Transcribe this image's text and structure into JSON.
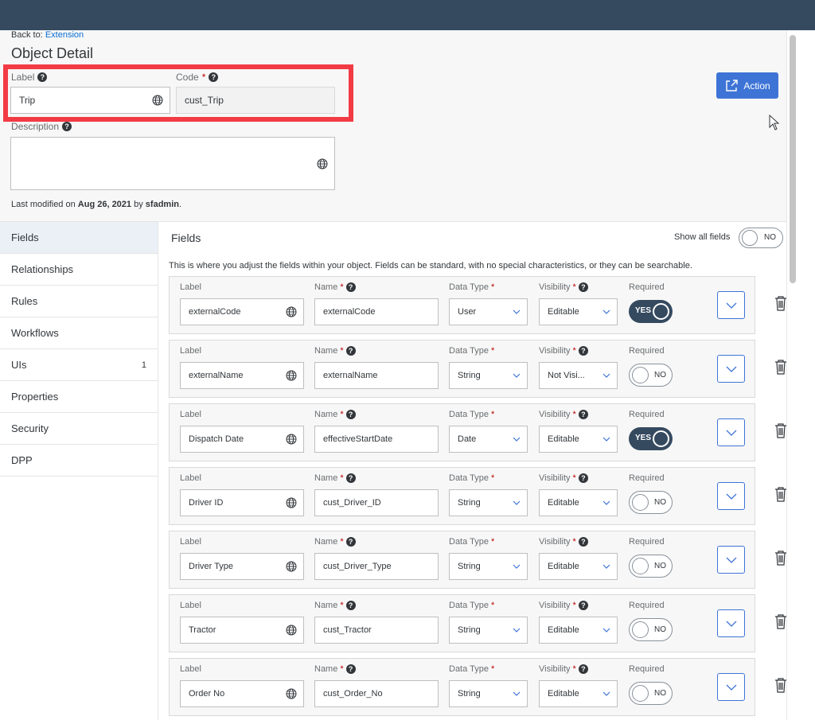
{
  "breadcrumb": {
    "prefix": "Back to:",
    "link": "Extension"
  },
  "page_title": "Object Detail",
  "header": {
    "label_caption": "Label",
    "label_value": "Trip",
    "code_caption": "Code",
    "code_value": "cust_Trip",
    "description_caption": "Description",
    "description_value": "",
    "action_label": "Action",
    "last_modified": {
      "prefix": "Last modified on",
      "date": "Aug 26, 2021",
      "by": "by",
      "user": "sfadmin",
      "suffix": "."
    }
  },
  "sidebar": {
    "items": [
      {
        "label": "Fields",
        "count": ""
      },
      {
        "label": "Relationships",
        "count": ""
      },
      {
        "label": "Rules",
        "count": ""
      },
      {
        "label": "Workflows",
        "count": ""
      },
      {
        "label": "UIs",
        "count": "1"
      },
      {
        "label": "Properties",
        "count": ""
      },
      {
        "label": "Security",
        "count": ""
      },
      {
        "label": "DPP",
        "count": ""
      }
    ]
  },
  "fields_panel": {
    "title": "Fields",
    "show_all_label": "Show all fields",
    "show_all_toggle": "NO",
    "description": "This is where you adjust the fields within your object. Fields can be standard, with no special characteristics, or they can be searchable.",
    "col_label": "Label",
    "col_name": "Name",
    "col_type": "Data Type",
    "col_visibility": "Visibility",
    "col_required": "Required",
    "rows": [
      {
        "label": "externalCode",
        "name": "externalCode",
        "type": "User",
        "visibility": "Editable",
        "required": "YES"
      },
      {
        "label": "externalName",
        "name": "externalName",
        "type": "String",
        "visibility": "Not Visi...",
        "required": "NO"
      },
      {
        "label": "Dispatch Date",
        "name": "effectiveStartDate",
        "type": "Date",
        "visibility": "Editable",
        "required": "YES"
      },
      {
        "label": "Driver ID",
        "name": "cust_Driver_ID",
        "type": "String",
        "visibility": "Editable",
        "required": "NO"
      },
      {
        "label": "Driver Type",
        "name": "cust_Driver_Type",
        "type": "String",
        "visibility": "Editable",
        "required": "NO"
      },
      {
        "label": "Tractor",
        "name": "cust_Tractor",
        "type": "String",
        "visibility": "Editable",
        "required": "NO"
      },
      {
        "label": "Order No",
        "name": "cust_Order_No",
        "type": "String",
        "visibility": "Editable",
        "required": "NO"
      }
    ]
  },
  "colors": {
    "shell": "#354a5f",
    "accent": "#3e74d6",
    "highlight": "#f23b45"
  }
}
